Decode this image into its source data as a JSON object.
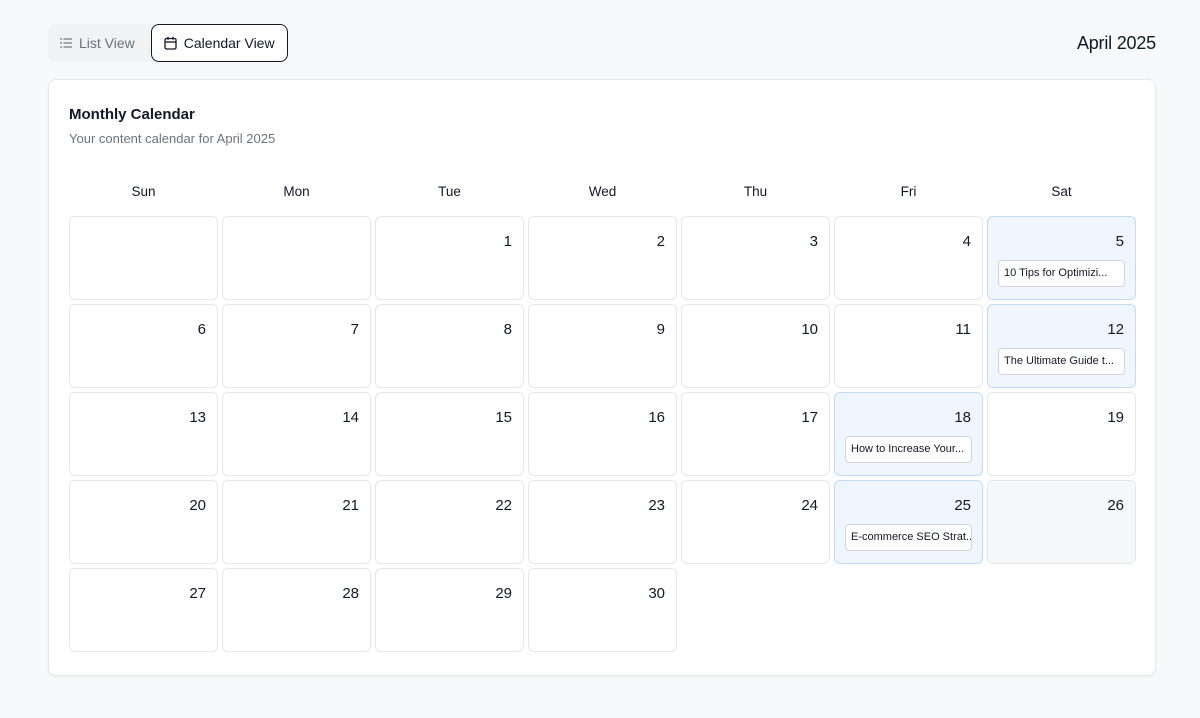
{
  "toolbar": {
    "list_view_label": "List View",
    "calendar_view_label": "Calendar View",
    "month_title": "April 2025"
  },
  "card": {
    "title": "Monthly Calendar",
    "subtitle": "Your content calendar for April 2025"
  },
  "weekdays": [
    "Sun",
    "Mon",
    "Tue",
    "Wed",
    "Thu",
    "Fri",
    "Sat"
  ],
  "days": {
    "d1": "1",
    "d2": "2",
    "d3": "3",
    "d4": "4",
    "d5": "5",
    "d6": "6",
    "d7": "7",
    "d8": "8",
    "d9": "9",
    "d10": "10",
    "d11": "11",
    "d12": "12",
    "d13": "13",
    "d14": "14",
    "d15": "15",
    "d16": "16",
    "d17": "17",
    "d18": "18",
    "d19": "19",
    "d20": "20",
    "d21": "21",
    "d22": "22",
    "d23": "23",
    "d24": "24",
    "d25": "25",
    "d26": "26",
    "d27": "27",
    "d28": "28",
    "d29": "29",
    "d30": "30"
  },
  "posts": {
    "p5": "10 Tips for Optimizi...",
    "p12": "The Ultimate Guide t...",
    "p18": "How to Increase Your...",
    "p25": "E-commerce SEO Strat..."
  },
  "colors": {
    "post_day_bg": "#eff6ff",
    "post_day_border": "#bfdbfe",
    "active_tab_border": "#111827"
  },
  "icons": {
    "list_view": "list-icon",
    "calendar_view": "calendar-icon"
  }
}
